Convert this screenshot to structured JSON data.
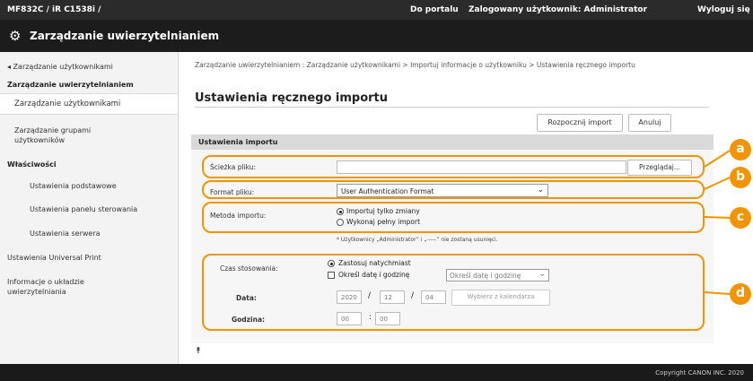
{
  "header": {
    "device": "MF832C / iR C1538i /",
    "portal": "Do portalu",
    "login_user": "Zalogowany użytkownik: Administrator",
    "logout": "Wyloguj się"
  },
  "app_title": "Zarządzanie uwierzytelnianiem",
  "sidebar": {
    "back": "◂ Zarządzanie użytkownikami",
    "section1": "Zarządzanie uwierzytelnianiem",
    "items1": [
      "Zarządzanie użytkownikami",
      "Zarządzanie grupami użytkowników"
    ],
    "section2": "Właściwości",
    "items2": [
      "Ustawienia podstawowe",
      "Ustawienia panelu sterowania",
      "Ustawienia serwera"
    ],
    "items3": [
      "Ustawienia Universal Print",
      "Informacje o układzie uwierzytelniania"
    ]
  },
  "breadcrumb": "Zarządzanie uwierzytelnianiem : Zarządzanie użytkownikami > Importuj informacje o użytkowniku > Ustawienia ręcznego importu",
  "page_title": "Ustawienia ręcznego importu",
  "buttons": {
    "start_import": "Rozpocznij import",
    "cancel": "Anuluj",
    "browse": "Przeglądaj..."
  },
  "section": "Ustawienia importu",
  "form": {
    "file_path_label": "Ścieżka pliku:",
    "file_format_label": "Format pliku:",
    "file_format_value": "User Authentication Format",
    "method_label": "Metoda importu:",
    "method_opt1": "Importuj tylko zmiany",
    "method_opt2": "Wykonaj pełny import",
    "note": "* Użytkownicy „Administrator” i „-----” nie zostaną usunięci.",
    "apply_time_label": "Czas stosowania:",
    "apply_opt1": "Zastosuj natychmiast",
    "apply_opt2": "Określ datę i godzinę",
    "apply_select": "Określ datę i godzinę",
    "date_label": "Data:",
    "year": "2020",
    "month": "12",
    "day": "04",
    "calendar": "Wybierz z kalendarza",
    "time_label": "Godzina:",
    "hour": "00",
    "minute": "00",
    "sep_date": "/",
    "sep_time": ":"
  },
  "callouts": [
    "a",
    "b",
    "c",
    "d"
  ],
  "to_top": "⯭",
  "footer": "Copyright CANON INC. 2020",
  "colors": {
    "callout": "#f29400",
    "topbar": "#2b2b2b"
  }
}
